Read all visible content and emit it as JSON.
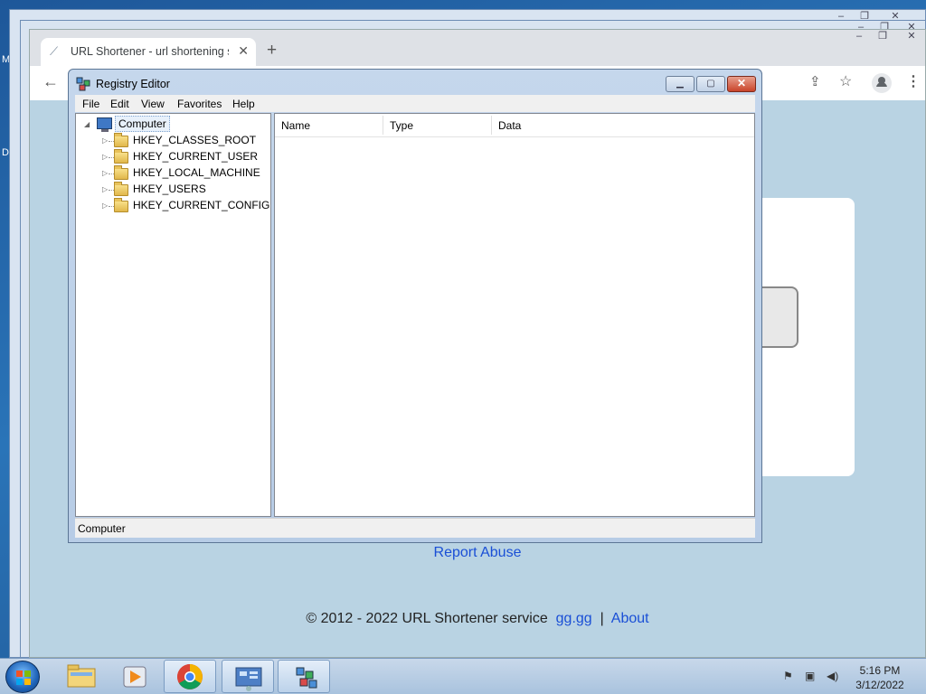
{
  "desktop": {
    "labels": [
      "M",
      "D"
    ]
  },
  "browser": {
    "tab_title": "URL Shortener - url shortening s",
    "new_tab": "+",
    "page": {
      "report_abuse": "Report Abuse",
      "footer_text": "© 2012 - 2022 URL Shortener service",
      "footer_link1": "gg.gg",
      "footer_sep": "|",
      "footer_link2": "About"
    }
  },
  "regedit": {
    "title": "Registry Editor",
    "menu": [
      "File",
      "Edit",
      "View",
      "Favorites",
      "Help"
    ],
    "tree": {
      "root": "Computer",
      "children": [
        "HKEY_CLASSES_ROOT",
        "HKEY_CURRENT_USER",
        "HKEY_LOCAL_MACHINE",
        "HKEY_USERS",
        "HKEY_CURRENT_CONFIG"
      ]
    },
    "columns": [
      "Name",
      "Type",
      "Data"
    ],
    "status": "Computer"
  },
  "taskbar": {
    "apps": [
      "windows-explorer",
      "media-player",
      "google-chrome",
      "control-panel",
      "registry-editor"
    ],
    "clock_time": "5:16 PM",
    "clock_date": "3/12/2022"
  }
}
